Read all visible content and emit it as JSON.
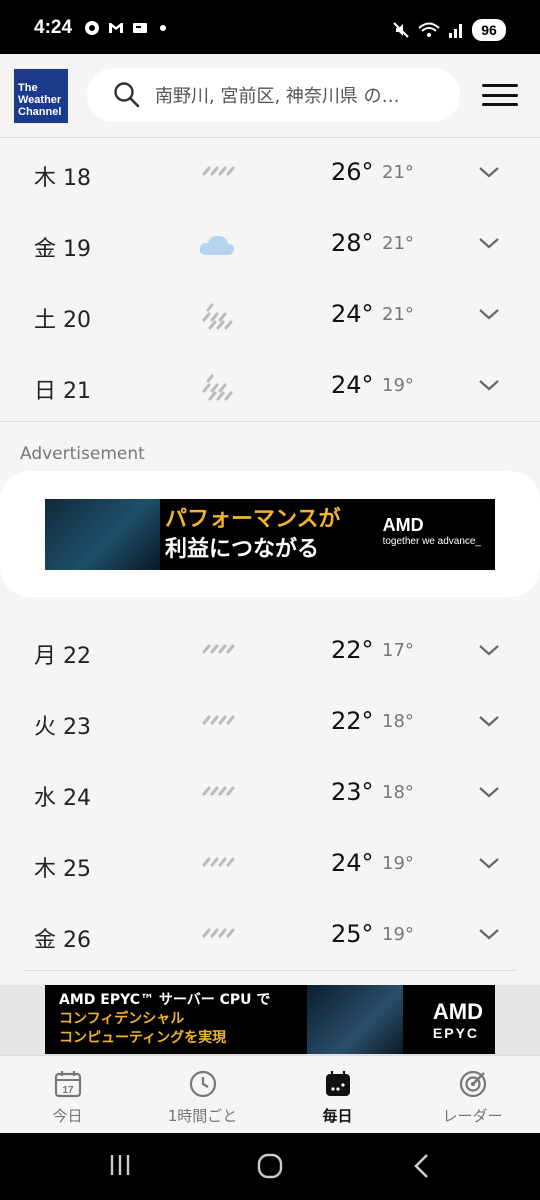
{
  "status": {
    "time": "4:24",
    "battery": "96"
  },
  "header": {
    "logo_lines": [
      "The",
      "Weather",
      "Channel"
    ],
    "search_text": "南野川, 宮前区, 神奈川県 の…"
  },
  "forecast_top": [
    {
      "day": "木 18",
      "icon": "rain-icon",
      "hi": "26°",
      "lo": "21°"
    },
    {
      "day": "金 19",
      "icon": "cloud-icon",
      "hi": "28°",
      "lo": "21°"
    },
    {
      "day": "土 20",
      "icon": "heavy-rain-icon",
      "hi": "24°",
      "lo": "21°"
    },
    {
      "day": "日 21",
      "icon": "heavy-rain-icon",
      "hi": "24°",
      "lo": "19°"
    }
  ],
  "ad": {
    "label": "Advertisement",
    "line1": "パフォーマンスが",
    "line2": "利益につながる",
    "brand": "AMD",
    "tagline": "together we advance_"
  },
  "forecast_bottom": [
    {
      "day": "月 22",
      "icon": "rain-icon",
      "hi": "22°",
      "lo": "17°"
    },
    {
      "day": "火 23",
      "icon": "rain-icon",
      "hi": "22°",
      "lo": "18°"
    },
    {
      "day": "水 24",
      "icon": "rain-icon",
      "hi": "23°",
      "lo": "18°"
    },
    {
      "day": "木 25",
      "icon": "rain-icon",
      "hi": "24°",
      "lo": "19°"
    },
    {
      "day": "金 26",
      "icon": "rain-icon",
      "hi": "25°",
      "lo": "19°"
    }
  ],
  "bottom_ad": {
    "line1": "AMD EPYC™ サーバー CPU で",
    "line2": "コンフィデンシャル",
    "line3": "コンピューティングを実現",
    "brand": "AMD",
    "sub": "EPYC"
  },
  "tabs": [
    {
      "label": "今日",
      "icon": "calendar-today-icon",
      "date": "17"
    },
    {
      "label": "1時間ごと",
      "icon": "clock-icon"
    },
    {
      "label": "毎日",
      "icon": "calendar-daily-icon",
      "active": true
    },
    {
      "label": "レーダー",
      "icon": "radar-icon"
    }
  ],
  "colors": {
    "brand": "#1c3a8c",
    "accent": "#f0b429",
    "cloud": "#b6d3f2"
  }
}
